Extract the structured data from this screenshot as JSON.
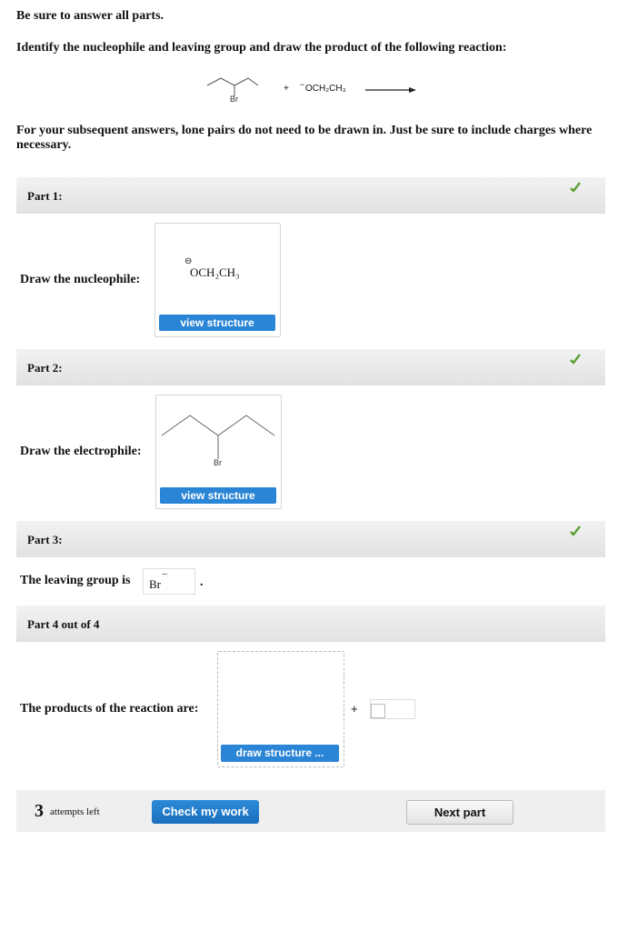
{
  "intro": {
    "line1": "Be sure to answer all parts.",
    "line2": "Identify the nucleophile and leaving group and draw the product of the following reaction:",
    "reaction": {
      "reactant1_label": "Br",
      "plus": "+",
      "reactant2_charge": "−",
      "reactant2": "OCH₂CH₃"
    },
    "line3": "For your subsequent answers, lone pairs do not need to be drawn in. Just be sure to include charges where necessary."
  },
  "parts": [
    {
      "title": "Part 1:",
      "status": "correct",
      "prompt": "Draw the nucleophile:",
      "structure_charge": "⊖",
      "structure_text": "OCH₂CH₃",
      "button": "view structure"
    },
    {
      "title": "Part 2:",
      "status": "correct",
      "prompt": "Draw the electrophile:",
      "structure_label": "Br",
      "button": "view structure"
    },
    {
      "title": "Part 3:",
      "status": "correct",
      "prompt": "The leaving group is",
      "answer": "Br",
      "answer_charge": "−",
      "period": "."
    },
    {
      "title": "Part 4 out of 4",
      "prompt": "The products of the reaction are:",
      "button": "draw structure ...",
      "plus": "+"
    }
  ],
  "footer": {
    "attempts_count": "3",
    "attempts_label": "attempts left",
    "check_button": "Check my work",
    "next_button": "Next part"
  },
  "colors": {
    "accent": "#2a85d6",
    "check": "#5a9e2f"
  }
}
